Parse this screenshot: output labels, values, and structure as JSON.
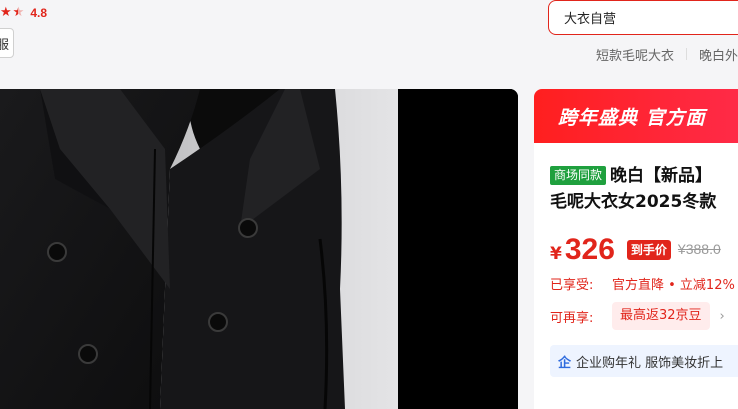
{
  "rating": {
    "score": "4.8",
    "stars_full": 2,
    "stars_half": 1
  },
  "left_tag": {
    "text": "服"
  },
  "search": {
    "value": "大衣自营"
  },
  "hot_words": [
    "短款毛呢大衣",
    "晚白外"
  ],
  "gallery": {
    "image_alt": "black wool coat product image"
  },
  "panel": {
    "banner": "跨年盛典 官方面",
    "badge": "商场同款",
    "title_line1": "晚白【新品】",
    "title_line2": "毛呢大衣女2025冬款",
    "price_currency": "¥",
    "price": "326",
    "price_tag": "到手价",
    "original_price": "¥388.0",
    "enjoyed_label": "已享受:",
    "enjoyed_value": "官方直降 • 立减12%",
    "more_label": "可再享:",
    "more_value": "最高返32京豆",
    "chevron": "›",
    "enterprise_icon": "企",
    "enterprise_text": "企业购年礼 服饰美妆折上"
  },
  "colors": {
    "accent": "#e1251b",
    "badge_green": "#1fa03e",
    "enterprise_blue": "#2e6bde"
  }
}
